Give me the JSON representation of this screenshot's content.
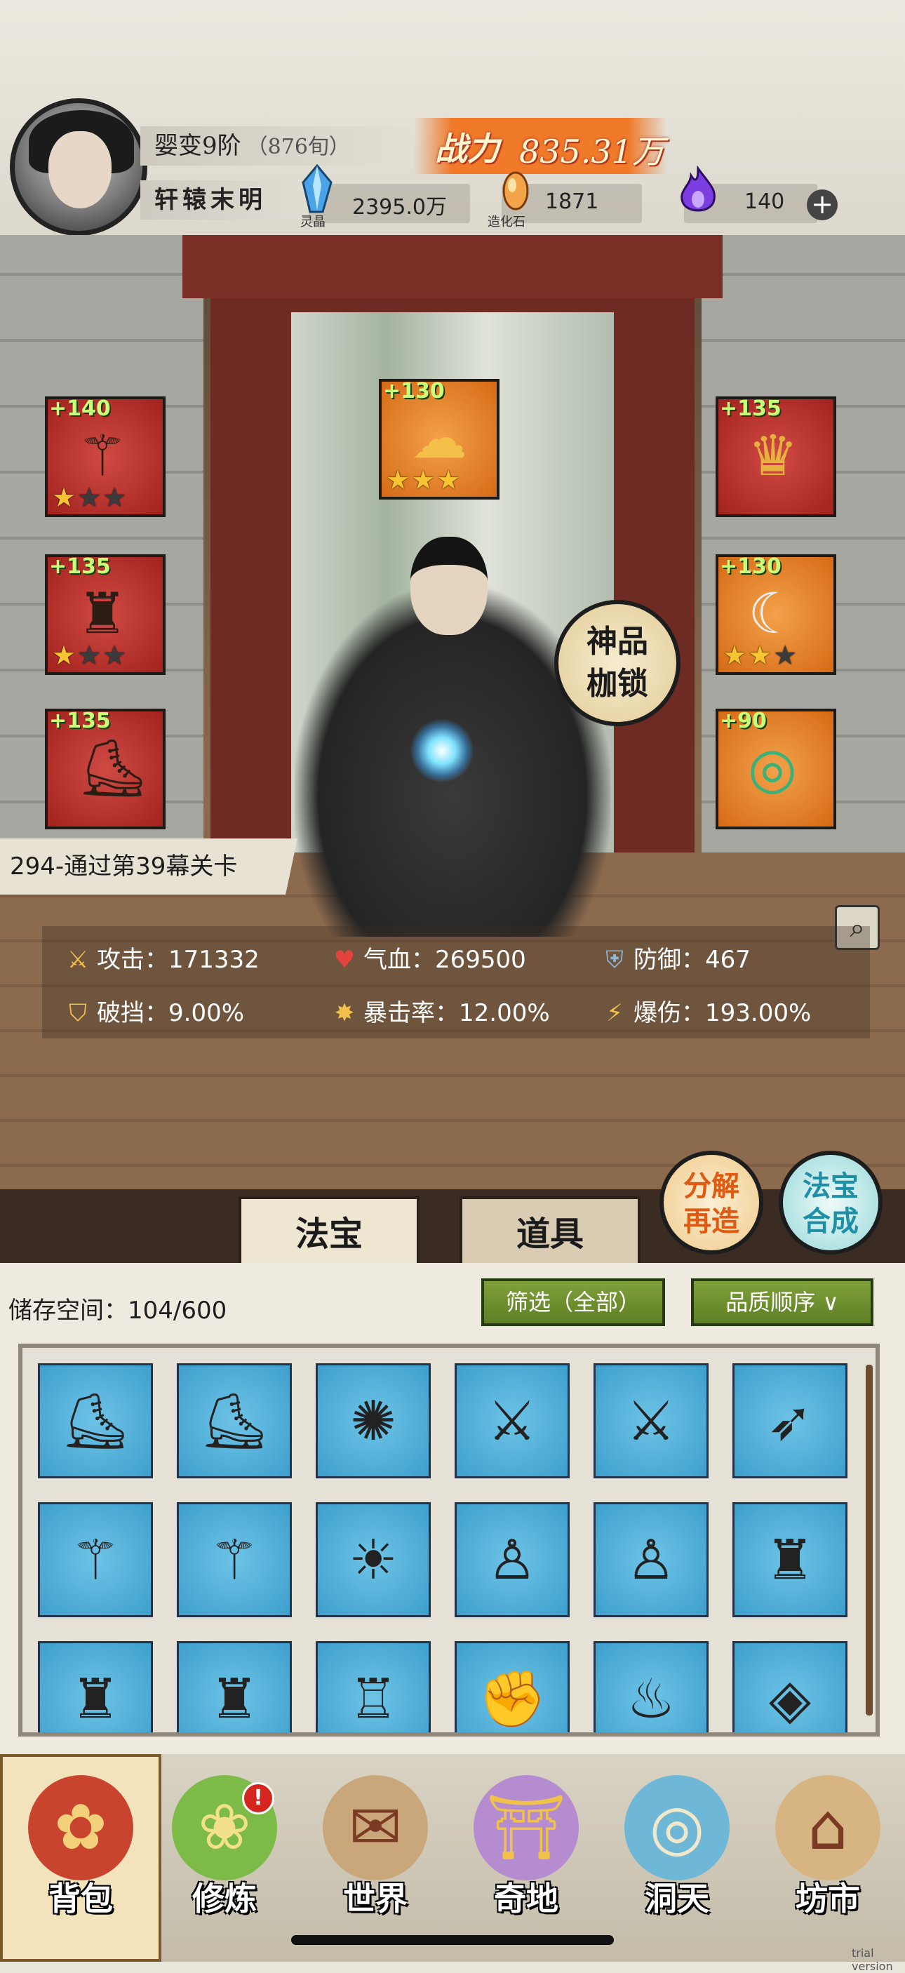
{
  "player": {
    "realm": "婴变9阶",
    "age": "（876旬）",
    "name": "轩辕末明",
    "power_label": "战力",
    "power_value": "835.31万"
  },
  "resources": [
    {
      "caption": "灵晶",
      "value": "2395.0万",
      "icon": "blue-crystal-icon"
    },
    {
      "caption": "造化石",
      "value": "1871",
      "icon": "orange-stone-icon"
    },
    {
      "caption": "",
      "value": "140",
      "icon": "purple-flame-icon"
    }
  ],
  "equipment": [
    {
      "bonus": "+140",
      "stars": 1,
      "max_stars": 3,
      "icon": "staff-icon",
      "color": "red"
    },
    {
      "bonus": "+130",
      "stars": 3,
      "max_stars": 3,
      "icon": "golden-cloud-ornament-icon",
      "color": "orange"
    },
    {
      "bonus": "+135",
      "stars": 0,
      "max_stars": 0,
      "icon": "crown-headband-icon",
      "color": "red"
    },
    {
      "bonus": "+135",
      "stars": 1,
      "max_stars": 3,
      "icon": "robe-icon",
      "color": "red"
    },
    {
      "bonus": "+130",
      "stars": 2,
      "max_stars": 3,
      "icon": "pendant-icon",
      "color": "orange"
    },
    {
      "bonus": "+135",
      "stars": 0,
      "max_stars": 0,
      "icon": "boots-icon",
      "color": "red"
    },
    {
      "bonus": "+90",
      "stars": 0,
      "max_stars": 0,
      "icon": "jade-ring-icon",
      "color": "orange"
    }
  ],
  "divine_badge": [
    "神品",
    "枷锁"
  ],
  "stage": "294-通过第39幕关卡",
  "stats": [
    {
      "label": "攻击：",
      "value": "171332",
      "icon": "sword-icon"
    },
    {
      "label": "气血：",
      "value": "269500",
      "icon": "heart-icon"
    },
    {
      "label": "防御：",
      "value": "467",
      "icon": "shield-icon"
    },
    {
      "label": "破挡：",
      "value": "9.00%",
      "icon": "broken-shield-icon"
    },
    {
      "label": "暴击率：",
      "value": "12.00%",
      "icon": "crit-burst-icon"
    },
    {
      "label": "爆伤：",
      "value": "193.00%",
      "icon": "crit-damage-icon"
    }
  ],
  "actions": {
    "decompose": [
      "分解",
      "再造"
    ],
    "synthesize": [
      "法宝",
      "合成"
    ]
  },
  "tabs": [
    "法宝",
    "道具"
  ],
  "inventory": {
    "storage_label": "储存空间：",
    "storage_value": "104/600",
    "filter": "筛选（全部）",
    "sort": "品质顺序",
    "items": [
      "red-boots-icon",
      "red-boots-icon",
      "dark-disc-icon",
      "ice-sword-icon",
      "ice-sword-icon",
      "frost-bow-icon",
      "golden-staff-icon",
      "golden-staff-icon",
      "golden-mask-icon",
      "white-armor-icon",
      "white-armor-icon",
      "red-armor-icon",
      "dark-robe-icon",
      "dark-robe-icon",
      "gold-armor-icon",
      "red-gauntlet-icon",
      "flame-boots-icon",
      "red-bracer-icon"
    ]
  },
  "nav": [
    {
      "label": "背包",
      "icon": "bag-icon"
    },
    {
      "label": "修炼",
      "icon": "lotus-icon",
      "badge": "!"
    },
    {
      "label": "世界",
      "icon": "scroll-map-icon"
    },
    {
      "label": "奇地",
      "icon": "pagoda-icon"
    },
    {
      "label": "洞天",
      "icon": "portal-icon"
    },
    {
      "label": "坊市",
      "icon": "market-stall-icon"
    }
  ],
  "watermark": "trial version"
}
